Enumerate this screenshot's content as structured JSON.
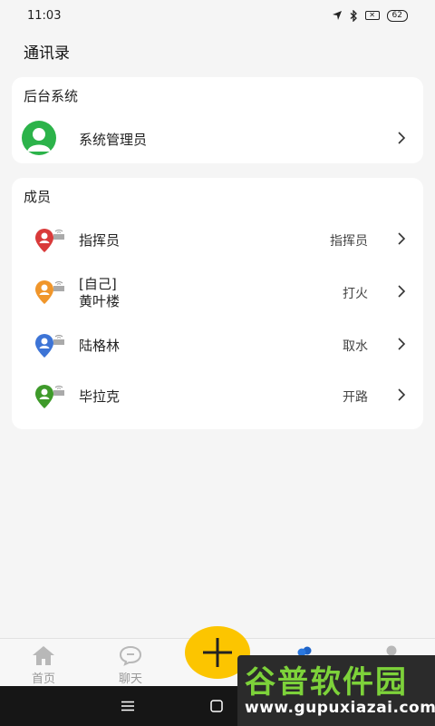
{
  "status_bar": {
    "time": "11:03",
    "battery": "62"
  },
  "page": {
    "title": "通讯录"
  },
  "backend": {
    "title": "后台系统",
    "admin": {
      "name": "系统管理员"
    }
  },
  "members": {
    "title": "成员",
    "items": [
      {
        "line1": "指挥员",
        "line2": "",
        "role": "指挥员",
        "color": "#d93a3a"
      },
      {
        "line1": "[自己]",
        "line2": "黄叶楼",
        "role": "打火",
        "color": "#f0962b"
      },
      {
        "line1": "陆格林",
        "line2": "",
        "role": "取水",
        "color": "#3d74d6"
      },
      {
        "line1": "毕拉克",
        "line2": "",
        "role": "开路",
        "color": "#3e9a2a"
      }
    ]
  },
  "nav": {
    "home": "首页",
    "chat": "聊天"
  },
  "watermark": {
    "title": "谷普软件园",
    "url": "www.gupuxiazai.com"
  },
  "colors": {
    "accent_fab": "#fcc500",
    "admin_avatar": "#2cb34a"
  }
}
